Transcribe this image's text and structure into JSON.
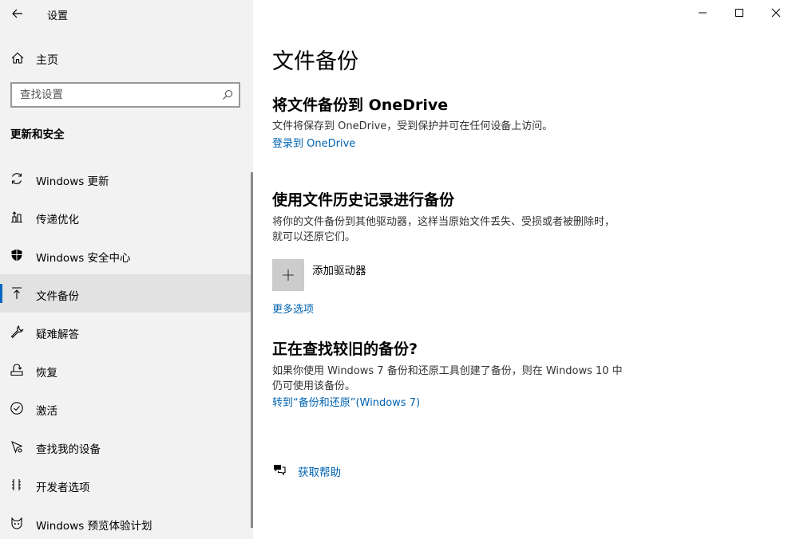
{
  "window": {
    "title": "设置",
    "controls": {
      "minimize": "minimize-icon",
      "maximize": "maximize-icon",
      "close": "close-icon"
    }
  },
  "sidebar": {
    "home_label": "主页",
    "search_placeholder": "查找设置",
    "section_title": "更新和安全",
    "items": [
      {
        "label": "Windows 更新",
        "icon": "sync-icon"
      },
      {
        "label": "传递优化",
        "icon": "delivery-optimization-icon"
      },
      {
        "label": "Windows 安全中心",
        "icon": "shield-icon"
      },
      {
        "label": "文件备份",
        "icon": "backup-icon",
        "selected": true
      },
      {
        "label": "疑难解答",
        "icon": "wrench-icon"
      },
      {
        "label": "恢复",
        "icon": "recovery-icon"
      },
      {
        "label": "激活",
        "icon": "check-circle-icon"
      },
      {
        "label": "查找我的设备",
        "icon": "find-device-icon"
      },
      {
        "label": "开发者选项",
        "icon": "developer-icon"
      },
      {
        "label": "Windows 预览体验计划",
        "icon": "insider-icon"
      }
    ]
  },
  "main": {
    "page_title": "文件备份",
    "onedrive": {
      "heading": "将文件备份到 OneDrive",
      "description": "文件将保存到 OneDrive，受到保护并可在任何设备上访问。",
      "link": "登录到 OneDrive"
    },
    "file_history": {
      "heading": "使用文件历史记录进行备份",
      "description": "将你的文件备份到其他驱动器，这样当原始文件丢失、受损或者被删除时，就可以还原它们。",
      "add_drive_label": "添加驱动器",
      "more_options": "更多选项"
    },
    "older_backup": {
      "heading": "正在查找较旧的备份?",
      "description": "如果你使用 Windows 7 备份和还原工具创建了备份，则在 Windows 10 中仍可使用该备份。",
      "link": "转到“备份和还原”(Windows 7)"
    },
    "help_link": "获取帮助"
  }
}
